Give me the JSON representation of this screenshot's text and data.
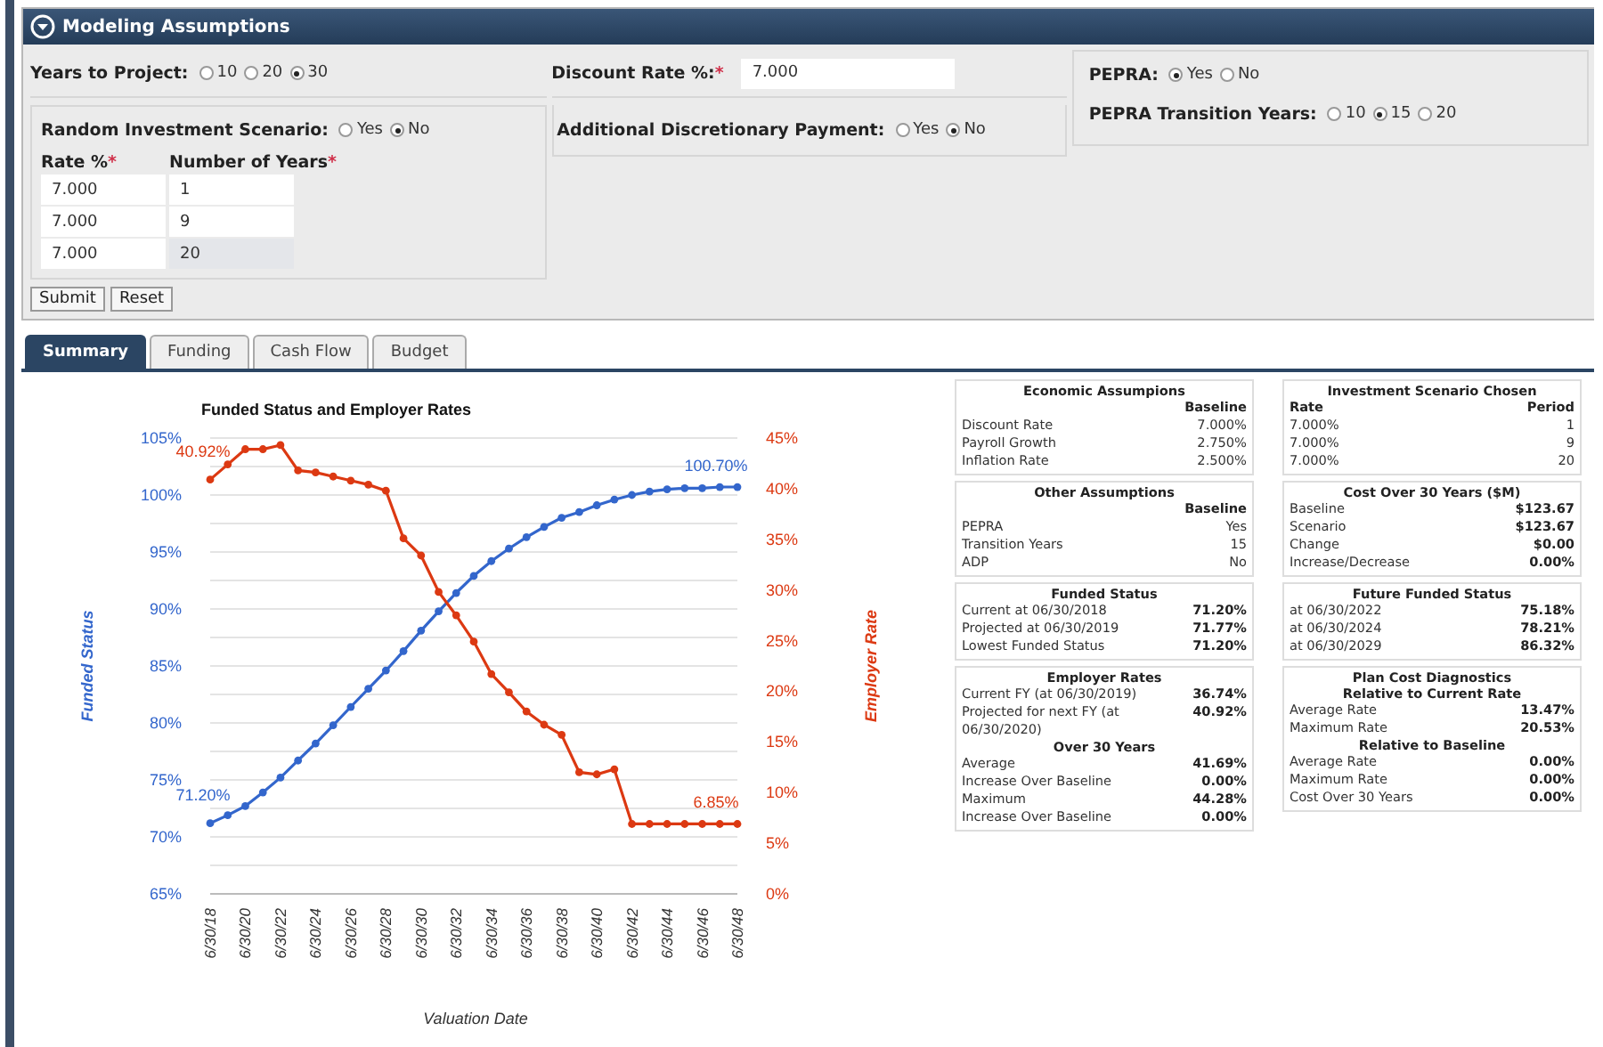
{
  "panel": {
    "title": "Modeling Assumptions",
    "years_to_project": {
      "label": "Years to Project:",
      "options": [
        {
          "label": "10",
          "selected": false
        },
        {
          "label": "20",
          "selected": false
        },
        {
          "label": "30",
          "selected": true
        }
      ]
    },
    "discount_rate": {
      "label": "Discount Rate %:",
      "mark": "*",
      "value": "7.000"
    },
    "pepra": {
      "label": "PEPRA:",
      "options": [
        {
          "label": "Yes",
          "selected": true
        },
        {
          "label": "No",
          "selected": false
        }
      ]
    },
    "pepra_transition_years": {
      "label": "PEPRA Transition Years:",
      "options": [
        {
          "label": "10",
          "selected": false
        },
        {
          "label": "15",
          "selected": true
        },
        {
          "label": "20",
          "selected": false
        }
      ]
    },
    "random_investment": {
      "label": "Random Investment Scenario:",
      "options": [
        {
          "label": "Yes",
          "selected": false
        },
        {
          "label": "No",
          "selected": true
        }
      ]
    },
    "scenario_table": {
      "columns": [
        {
          "label": "Rate %",
          "mark": "*"
        },
        {
          "label": "Number of Years",
          "mark": "*"
        }
      ],
      "rows": [
        {
          "rate": "7.000",
          "years": "1",
          "years_disabled": false
        },
        {
          "rate": "7.000",
          "years": "9",
          "years_disabled": false
        },
        {
          "rate": "7.000",
          "years": "20",
          "years_disabled": true
        }
      ]
    },
    "additional_payment": {
      "label": "Additional Discretionary Payment:",
      "options": [
        {
          "label": "Yes",
          "selected": false
        },
        {
          "label": "No",
          "selected": true
        }
      ]
    },
    "buttons": [
      "Submit",
      "Reset"
    ]
  },
  "tabs": [
    {
      "label": "Summary",
      "selected": true
    },
    {
      "label": "Funding",
      "selected": false
    },
    {
      "label": "Cash Flow",
      "selected": false
    },
    {
      "label": "Budget",
      "selected": false
    }
  ],
  "chart": {
    "chart_data": {
      "type": "line",
      "title": "Funded Status and Employer Rates",
      "xlabel": "Valuation Date",
      "categories": [
        "6/30/18",
        null,
        "6/30/20",
        null,
        "6/30/22",
        null,
        "6/30/24",
        null,
        "6/30/26",
        null,
        "6/30/28",
        null,
        "6/30/30",
        null,
        "6/30/32",
        null,
        "6/30/34",
        null,
        "6/30/36",
        null,
        "6/30/38",
        null,
        "6/30/40",
        null,
        "6/30/42",
        null,
        "6/30/44",
        null,
        "6/30/46",
        null,
        "6/30/48"
      ],
      "ylim": [
        65,
        105
      ],
      "yticks": [
        {
          "value": 65,
          "label": "65%"
        },
        {
          "value": 70,
          "label": "70%"
        },
        {
          "value": 75,
          "label": "75%"
        },
        {
          "value": 80,
          "label": "80%"
        },
        {
          "value": 85,
          "label": "85%"
        },
        {
          "value": 90,
          "label": "90%"
        },
        {
          "value": 95,
          "label": "95%"
        },
        {
          "value": 100,
          "label": "100%"
        },
        {
          "value": 105,
          "label": "105%"
        }
      ],
      "y2lim": [
        0,
        45
      ],
      "y2ticks": [
        {
          "value": 0,
          "label": "0%"
        },
        {
          "value": 5,
          "label": "5%"
        },
        {
          "value": 10,
          "label": "10%"
        },
        {
          "value": 15,
          "label": "15%"
        },
        {
          "value": 20,
          "label": "20%"
        },
        {
          "value": 25,
          "label": "25%"
        },
        {
          "value": 30,
          "label": "30%"
        },
        {
          "value": 35,
          "label": "35%"
        },
        {
          "value": 40,
          "label": "40%"
        },
        {
          "value": 45,
          "label": "45%"
        }
      ],
      "series": [
        {
          "name": "Funded Status",
          "color": "#3366cc",
          "marker": "circle",
          "values": [
            71.2,
            71.9,
            72.7,
            73.9,
            75.2,
            76.7,
            78.2,
            79.8,
            81.4,
            83.0,
            84.6,
            86.3,
            88.1,
            89.8,
            91.4,
            92.9,
            94.2,
            95.3,
            96.3,
            97.2,
            98.0,
            98.5,
            99.1,
            99.6,
            100.0,
            100.3,
            100.5,
            100.6,
            100.6,
            100.7,
            100.7
          ]
        },
        {
          "name": "Employer Rate",
          "color": "#dc3912",
          "axis": "y2",
          "marker": "circle",
          "values": [
            40.9,
            42.4,
            43.9,
            43.9,
            44.3,
            41.8,
            41.6,
            41.2,
            40.8,
            40.4,
            39.8,
            35.1,
            33.4,
            29.8,
            27.5,
            24.9,
            21.7,
            19.9,
            18.0,
            16.7,
            15.7,
            12.0,
            11.8,
            12.3,
            6.9,
            6.9,
            6.9,
            6.9,
            6.9,
            6.9,
            6.9
          ]
        }
      ],
      "grid": true,
      "annotations": [
        "40.92%",
        {
          "x": "6/30/48",
          "y": 100.7,
          "text": "100.70%"
        },
        {
          "x": "6/30/18",
          "y": 71.2,
          "text": "71.20%"
        },
        "6.85%"
      ]
    }
  },
  "summary": {
    "columns": [
      [
        {
          "title": "Economic Assumpions",
          "bold_values": false,
          "rows": [
            {
              "kind": "header",
              "value": "Baseline"
            },
            {
              "kind": "row",
              "label": "Discount Rate",
              "value": "7.000%"
            },
            {
              "kind": "row",
              "label": "Payroll Growth",
              "value": "2.750%"
            },
            {
              "kind": "row",
              "label": "Inflation Rate",
              "value": "2.500%"
            }
          ]
        },
        {
          "title": "Other Assumptions",
          "bold_values": false,
          "rows": [
            {
              "kind": "header",
              "value": "Baseline"
            },
            {
              "kind": "row",
              "label": "PEPRA",
              "value": "Yes"
            },
            {
              "kind": "row",
              "label": "Transition Years",
              "value": "15"
            },
            {
              "kind": "row",
              "label": "ADP",
              "value": "No"
            }
          ]
        },
        {
          "title": "Funded Status",
          "bold_values": true,
          "rows": [
            {
              "kind": "row",
              "label": "Current at 06/30/2018",
              "value": "71.20%"
            },
            {
              "kind": "row",
              "label": "Projected at 06/30/2019",
              "value": "71.77%"
            },
            {
              "kind": "row",
              "label": "Lowest Funded Status",
              "value": "71.20%"
            }
          ]
        },
        {
          "title": "Employer Rates",
          "bold_values": true,
          "rows": [
            {
              "kind": "row",
              "label": "Current FY (at 06/30/2019)",
              "value": "36.74%"
            },
            {
              "kind": "row",
              "label": "Projected for next FY (at 06/30/2020)",
              "value": "40.92%"
            },
            {
              "kind": "subheading",
              "label": "Over 30 Years"
            },
            {
              "kind": "row",
              "label": "Average",
              "value": "41.69%"
            },
            {
              "kind": "row",
              "label": "Increase Over Baseline",
              "value": "0.00%"
            },
            {
              "kind": "row",
              "label": "Maximum",
              "value": "44.28%"
            },
            {
              "kind": "row",
              "label": "Increase Over Baseline",
              "value": "0.00%"
            }
          ]
        }
      ],
      [
        {
          "title": "Investment Scenario Chosen",
          "bold_values": false,
          "rows": [
            {
              "kind": "header",
              "label": "Rate",
              "value": "Period"
            },
            {
              "kind": "row",
              "label": "7.000%",
              "value": "1"
            },
            {
              "kind": "row",
              "label": "7.000%",
              "value": "9"
            },
            {
              "kind": "row",
              "label": "7.000%",
              "value": "20"
            }
          ]
        },
        {
          "title": "Cost Over 30 Years ($M)",
          "bold_values": true,
          "rows": [
            {
              "kind": "row",
              "label": "Baseline",
              "value": "$123.67"
            },
            {
              "kind": "row",
              "label": "Scenario",
              "value": "$123.67"
            },
            {
              "kind": "row",
              "label": "Change",
              "value": "$0.00"
            },
            {
              "kind": "row",
              "label": "Increase/Decrease",
              "value": "0.00%"
            }
          ]
        },
        {
          "title": "Future Funded Status",
          "bold_values": true,
          "rows": [
            {
              "kind": "row",
              "label": "at 06/30/2022",
              "value": "75.18%"
            },
            {
              "kind": "row",
              "label": "at 06/30/2024",
              "value": "78.21%"
            },
            {
              "kind": "row",
              "label": "at 06/30/2029",
              "value": "86.32%"
            }
          ]
        },
        {
          "title": "Plan Cost Diagnostics",
          "bold_values": true,
          "rows": [
            {
              "kind": "subheading",
              "label": "Relative to Current Rate"
            },
            {
              "kind": "row",
              "label": "Average Rate",
              "value": "13.47%"
            },
            {
              "kind": "row",
              "label": "Maximum Rate",
              "value": "20.53%"
            },
            {
              "kind": "subheading",
              "label": "Relative to Baseline"
            },
            {
              "kind": "row",
              "label": "Average Rate",
              "value": "0.00%"
            },
            {
              "kind": "row",
              "label": "Maximum Rate",
              "value": "0.00%"
            },
            {
              "kind": "row",
              "label": "Cost Over 30 Years",
              "value": "0.00%"
            }
          ]
        }
      ]
    ]
  }
}
